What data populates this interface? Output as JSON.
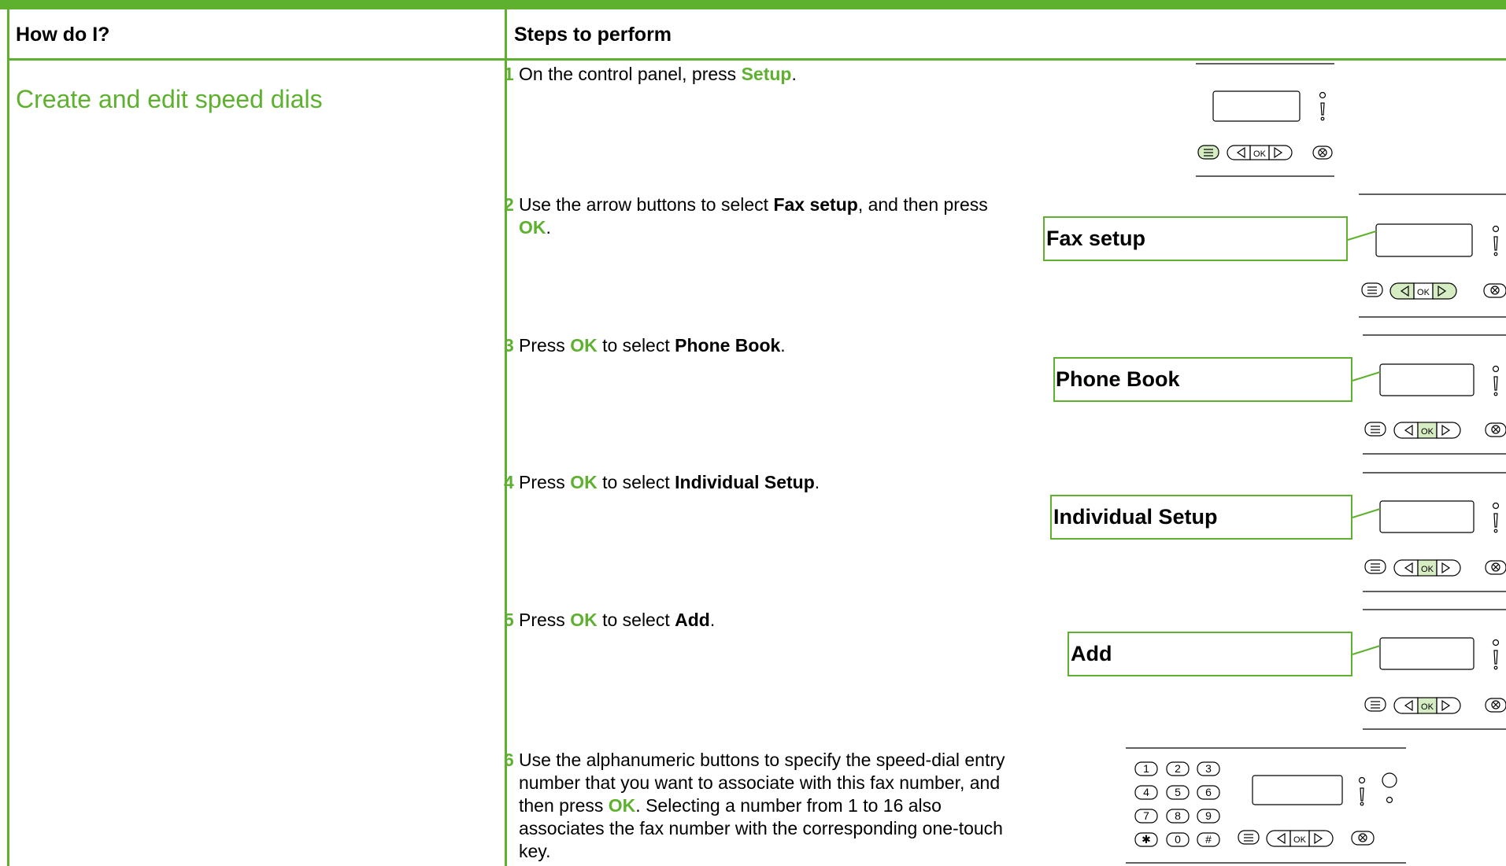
{
  "table": {
    "col1_header": "How do I?",
    "col2_header": "Steps to perform",
    "task_title": "Create and edit speed dials"
  },
  "steps": [
    {
      "number": "1",
      "parts": [
        "On the control panel, press ",
        "Setup",
        "."
      ]
    },
    {
      "number": "2",
      "parts": [
        "Use the arrow buttons to select ",
        "Fax setup",
        ", and then press ",
        "OK",
        "."
      ]
    },
    {
      "number": "3",
      "parts": [
        "Press ",
        "OK",
        " to select ",
        "Phone Book",
        "."
      ]
    },
    {
      "number": "4",
      "parts": [
        "Press ",
        "OK",
        " to select ",
        "Individual Setup",
        "."
      ]
    },
    {
      "number": "5",
      "parts": [
        "Press ",
        "OK",
        " to select ",
        "Add",
        "."
      ]
    },
    {
      "number": "6",
      "parts": [
        "Use the alphanumeric buttons to specify the speed-dial entry number that you want to associate with this fax number, and then press ",
        "OK",
        ". Selecting a number from 1 to 16 also associates the fax number with the corresponding one-touch key."
      ]
    }
  ],
  "callouts": {
    "step2": "Fax setup",
    "step3": "Phone Book",
    "step4": "Individual Setup",
    "step5": "Add"
  },
  "panel": {
    "ok_label": "OK",
    "keypad": [
      "1",
      "2",
      "3",
      "4",
      "5",
      "6",
      "7",
      "8",
      "9",
      "✱",
      "0",
      "#"
    ]
  },
  "colors": {
    "accent": "#5eb12f",
    "highlight": "#d6ecc3"
  }
}
